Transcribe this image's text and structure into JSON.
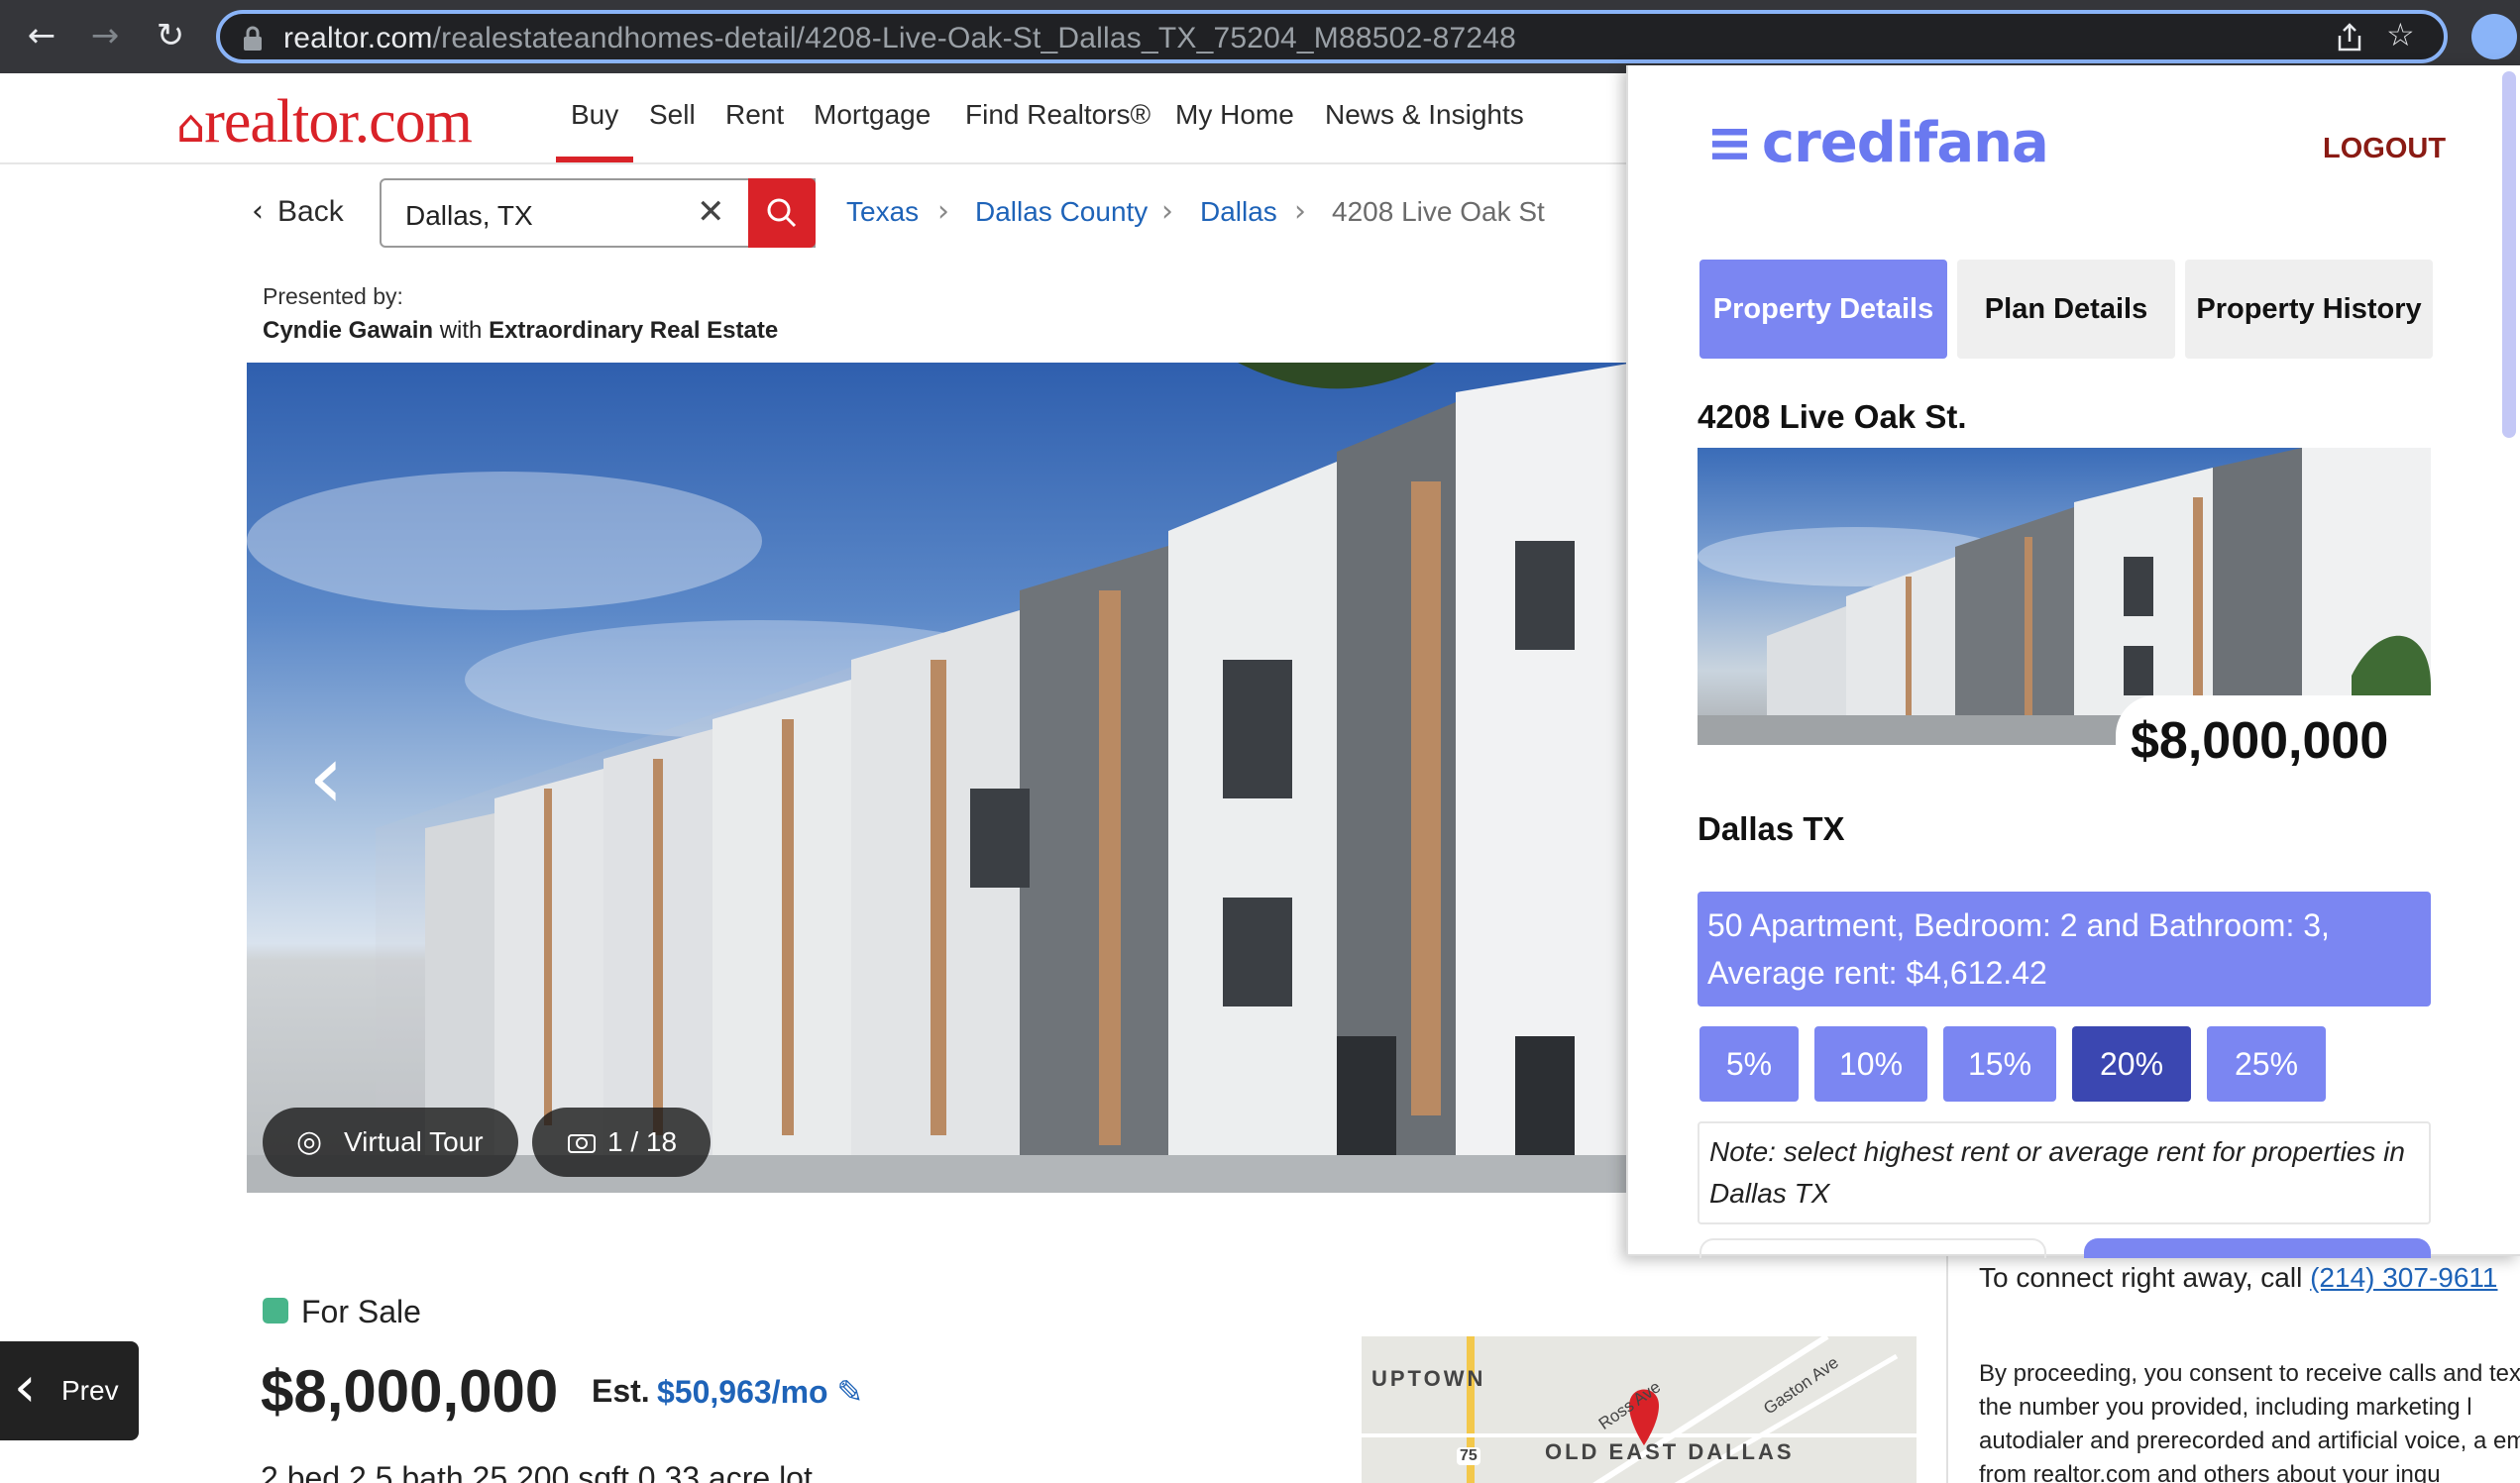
{
  "browser": {
    "url_host": "realtor.com",
    "url_path": "/realestateandhomes-detail/4208-Live-Oak-St_Dallas_TX_75204_M88502-87248"
  },
  "header": {
    "logo": "realtor.com",
    "nav": [
      "Buy",
      "Sell",
      "Rent",
      "Mortgage",
      "Find Realtors®",
      "My Home",
      "News & Insights"
    ],
    "active_nav": "Buy"
  },
  "search": {
    "back_label": "Back",
    "value": "Dallas, TX"
  },
  "breadcrumb": [
    "Texas",
    "Dallas County",
    "Dallas",
    "4208 Live Oak St"
  ],
  "presenter": {
    "label": "Presented by:",
    "agent": "Cyndie Gawain",
    "with": "with",
    "brokerage": "Extraordinary Real Estate"
  },
  "gallery": {
    "virtual_tour": "Virtual Tour",
    "counter": "1 / 18",
    "prev_label": "Prev"
  },
  "listing": {
    "status": "For Sale",
    "price": "$8,000,000",
    "est_label": "Est.",
    "est_value": "$50,963/mo",
    "facts": "2 bed   2.5 bath   25,200 sqft   0.33 acre lot"
  },
  "map": {
    "labels": [
      "UPTOWN",
      "OLD EAST DALLAS",
      "Ross Ave",
      "Gaston Ave",
      "75"
    ]
  },
  "contact": {
    "connect_text": "To connect right away, call",
    "phone": "(214) 307-9611",
    "consent": "By proceeding, you consent to receive calls and tex at the number you provided, including marketing l autodialer and prerecorded and artificial voice, a email, from realtor.com and others about your inqu"
  },
  "credifana": {
    "brand": "credifana",
    "logout": "LOGOUT",
    "tabs": [
      "Property Details",
      "Plan Details",
      "Property History"
    ],
    "active_tab": "Property Details",
    "address": "4208 Live Oak St.",
    "price": "$8,000,000",
    "city": "Dallas TX",
    "summary": "50 Apartment, Bedroom: 2 and Bathroom: 3, Average rent: $4,612.42",
    "down_payments": [
      "5%",
      "10%",
      "15%",
      "20%",
      "25%"
    ],
    "selected_down_payment": "20%",
    "note": "Note: select highest rent or average rent for properties in Dallas TX",
    "accent_color": "#7b86f2",
    "selected_color": "#3b47b1"
  }
}
